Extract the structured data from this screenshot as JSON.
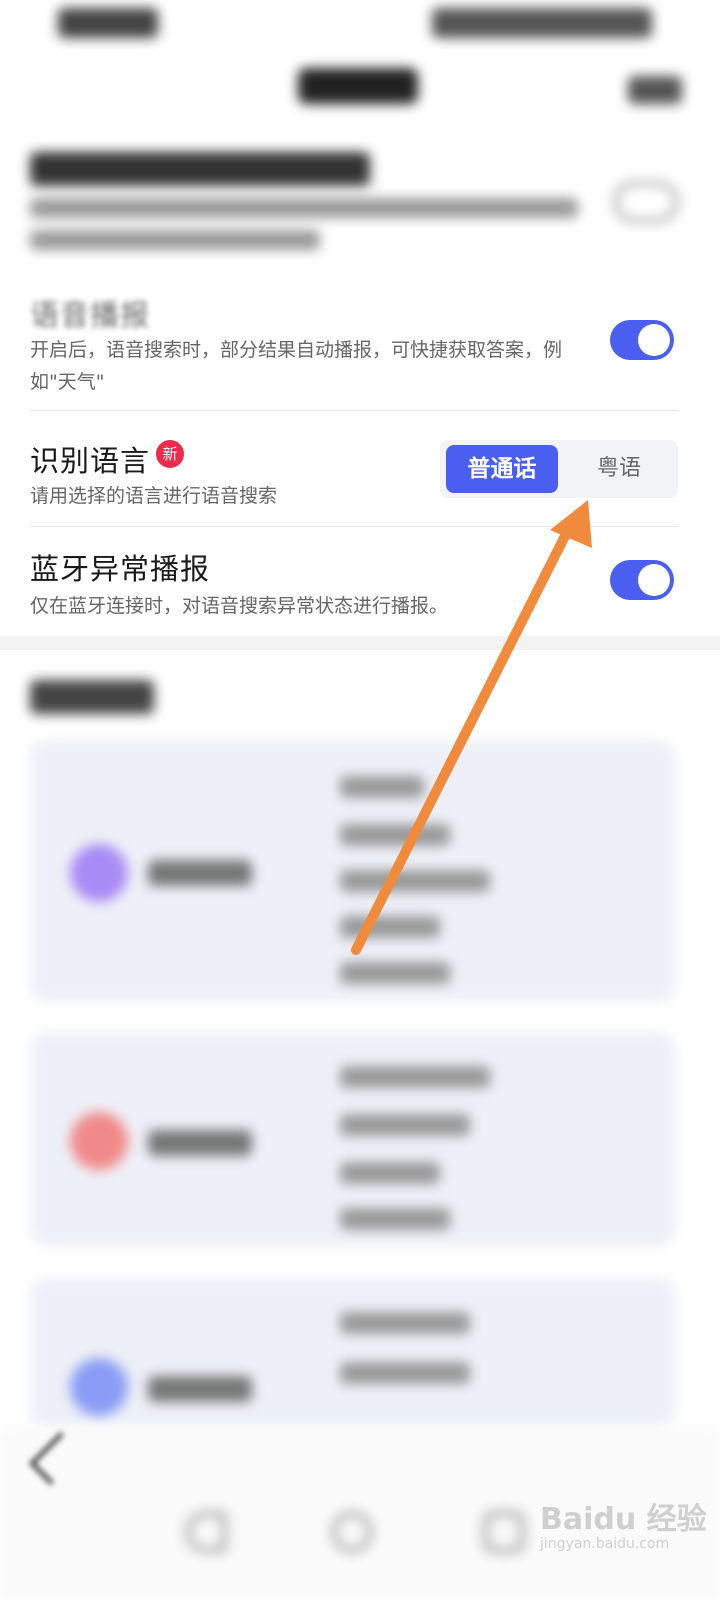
{
  "settings": {
    "voice_broadcast": {
      "title": "语音播报",
      "description": "开启后，语音搜索时，部分结果自动播报，可快捷获取答案，例如\"天气\"",
      "enabled": true
    },
    "recognize_language": {
      "title": "识别语言",
      "badge": "新",
      "description": "请用选择的语言进行语音搜索",
      "options": [
        "普通话",
        "粤语"
      ],
      "selected": "普通话"
    },
    "bluetooth_broadcast": {
      "title": "蓝牙异常播报",
      "description": "仅在蓝牙连接时，对语音搜索异常状态进行播报。",
      "enabled": true
    }
  },
  "colors": {
    "accent": "#4a5ff0",
    "badge": "#f0284a",
    "arrow": "#f08a3c"
  },
  "watermark": {
    "text": "Baidu 经验",
    "url_text": "jingyan.baidu.com"
  }
}
